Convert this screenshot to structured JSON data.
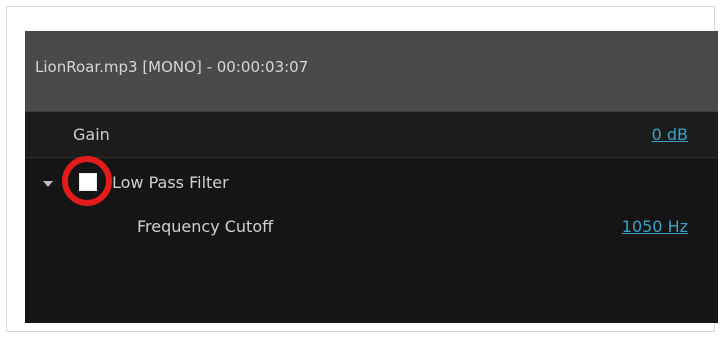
{
  "panel": {
    "title": "LionRoar.mp3  [MONO] - 00:00:03:07"
  },
  "rows": {
    "gain": {
      "label": "Gain",
      "value": "0 dB"
    },
    "low_pass_filter": {
      "label": "Low Pass Filter",
      "expanded": true,
      "checked": false,
      "highlight_color": "#e31b1b",
      "frequency_cutoff": {
        "label": "Frequency Cutoff",
        "value": "1050 Hz"
      }
    }
  },
  "colors": {
    "title_bar": "#4a4a4a",
    "panel_background": "#151515",
    "link_value": "#3da1c8"
  }
}
